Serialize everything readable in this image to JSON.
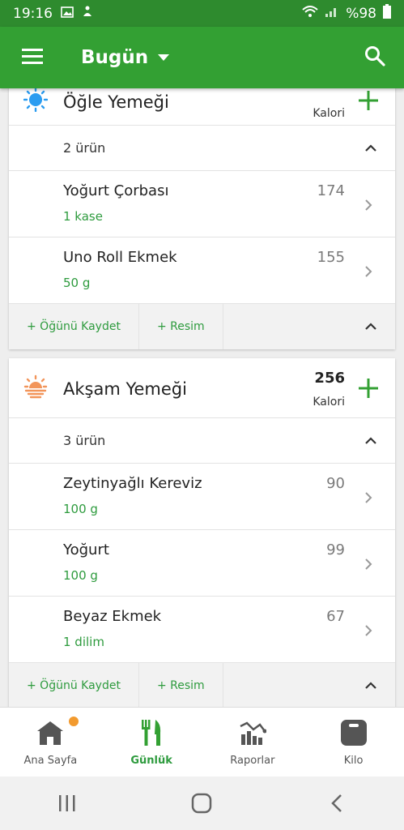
{
  "status_bar": {
    "time": "19:16",
    "battery": "%98"
  },
  "app_bar": {
    "title": "Bugün"
  },
  "meals": [
    {
      "name": "Öğle Yemeği",
      "calories": "",
      "calories_label": "Kalori",
      "count_text": "2 ürün",
      "items": [
        {
          "name": "Yoğurt Çorbası",
          "qty": "1 kase",
          "cal": "174"
        },
        {
          "name": "Uno Roll Ekmek",
          "qty": "50 g",
          "cal": "155"
        }
      ],
      "actions": {
        "save": "+ Öğünü Kaydet",
        "photo": "+ Resim"
      }
    },
    {
      "name": "Akşam Yemeği",
      "calories": "256",
      "calories_label": "Kalori",
      "count_text": "3 ürün",
      "items": [
        {
          "name": "Zeytinyağlı Kereviz",
          "qty": "100 g",
          "cal": "90"
        },
        {
          "name": "Yoğurt",
          "qty": "100 g",
          "cal": "99"
        },
        {
          "name": "Beyaz Ekmek",
          "qty": "1 dilim",
          "cal": "67"
        }
      ],
      "actions": {
        "save": "+ Öğünü Kaydet",
        "photo": "+ Resim"
      }
    }
  ],
  "bottom_nav": [
    {
      "label": "Ana Sayfa",
      "icon": "home-icon"
    },
    {
      "label": "Günlük",
      "icon": "diary-icon"
    },
    {
      "label": "Raporlar",
      "icon": "reports-icon"
    },
    {
      "label": "Kilo",
      "icon": "scale-icon"
    }
  ],
  "colors": {
    "primary": "#33a033",
    "accent_text": "#2e9b3e",
    "badge": "#f29a2e"
  }
}
